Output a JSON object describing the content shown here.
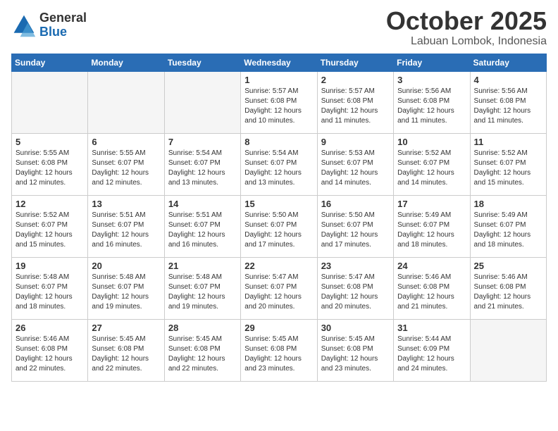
{
  "logo": {
    "general": "General",
    "blue": "Blue"
  },
  "title": "October 2025",
  "location": "Labuan Lombok, Indonesia",
  "days_of_week": [
    "Sunday",
    "Monday",
    "Tuesday",
    "Wednesday",
    "Thursday",
    "Friday",
    "Saturday"
  ],
  "weeks": [
    [
      {
        "day": "",
        "info": ""
      },
      {
        "day": "",
        "info": ""
      },
      {
        "day": "",
        "info": ""
      },
      {
        "day": "1",
        "info": "Sunrise: 5:57 AM\nSunset: 6:08 PM\nDaylight: 12 hours and 10 minutes."
      },
      {
        "day": "2",
        "info": "Sunrise: 5:57 AM\nSunset: 6:08 PM\nDaylight: 12 hours and 11 minutes."
      },
      {
        "day": "3",
        "info": "Sunrise: 5:56 AM\nSunset: 6:08 PM\nDaylight: 12 hours and 11 minutes."
      },
      {
        "day": "4",
        "info": "Sunrise: 5:56 AM\nSunset: 6:08 PM\nDaylight: 12 hours and 11 minutes."
      }
    ],
    [
      {
        "day": "5",
        "info": "Sunrise: 5:55 AM\nSunset: 6:08 PM\nDaylight: 12 hours and 12 minutes."
      },
      {
        "day": "6",
        "info": "Sunrise: 5:55 AM\nSunset: 6:07 PM\nDaylight: 12 hours and 12 minutes."
      },
      {
        "day": "7",
        "info": "Sunrise: 5:54 AM\nSunset: 6:07 PM\nDaylight: 12 hours and 13 minutes."
      },
      {
        "day": "8",
        "info": "Sunrise: 5:54 AM\nSunset: 6:07 PM\nDaylight: 12 hours and 13 minutes."
      },
      {
        "day": "9",
        "info": "Sunrise: 5:53 AM\nSunset: 6:07 PM\nDaylight: 12 hours and 14 minutes."
      },
      {
        "day": "10",
        "info": "Sunrise: 5:52 AM\nSunset: 6:07 PM\nDaylight: 12 hours and 14 minutes."
      },
      {
        "day": "11",
        "info": "Sunrise: 5:52 AM\nSunset: 6:07 PM\nDaylight: 12 hours and 15 minutes."
      }
    ],
    [
      {
        "day": "12",
        "info": "Sunrise: 5:52 AM\nSunset: 6:07 PM\nDaylight: 12 hours and 15 minutes."
      },
      {
        "day": "13",
        "info": "Sunrise: 5:51 AM\nSunset: 6:07 PM\nDaylight: 12 hours and 16 minutes."
      },
      {
        "day": "14",
        "info": "Sunrise: 5:51 AM\nSunset: 6:07 PM\nDaylight: 12 hours and 16 minutes."
      },
      {
        "day": "15",
        "info": "Sunrise: 5:50 AM\nSunset: 6:07 PM\nDaylight: 12 hours and 17 minutes."
      },
      {
        "day": "16",
        "info": "Sunrise: 5:50 AM\nSunset: 6:07 PM\nDaylight: 12 hours and 17 minutes."
      },
      {
        "day": "17",
        "info": "Sunrise: 5:49 AM\nSunset: 6:07 PM\nDaylight: 12 hours and 18 minutes."
      },
      {
        "day": "18",
        "info": "Sunrise: 5:49 AM\nSunset: 6:07 PM\nDaylight: 12 hours and 18 minutes."
      }
    ],
    [
      {
        "day": "19",
        "info": "Sunrise: 5:48 AM\nSunset: 6:07 PM\nDaylight: 12 hours and 18 minutes."
      },
      {
        "day": "20",
        "info": "Sunrise: 5:48 AM\nSunset: 6:07 PM\nDaylight: 12 hours and 19 minutes."
      },
      {
        "day": "21",
        "info": "Sunrise: 5:48 AM\nSunset: 6:07 PM\nDaylight: 12 hours and 19 minutes."
      },
      {
        "day": "22",
        "info": "Sunrise: 5:47 AM\nSunset: 6:07 PM\nDaylight: 12 hours and 20 minutes."
      },
      {
        "day": "23",
        "info": "Sunrise: 5:47 AM\nSunset: 6:08 PM\nDaylight: 12 hours and 20 minutes."
      },
      {
        "day": "24",
        "info": "Sunrise: 5:46 AM\nSunset: 6:08 PM\nDaylight: 12 hours and 21 minutes."
      },
      {
        "day": "25",
        "info": "Sunrise: 5:46 AM\nSunset: 6:08 PM\nDaylight: 12 hours and 21 minutes."
      }
    ],
    [
      {
        "day": "26",
        "info": "Sunrise: 5:46 AM\nSunset: 6:08 PM\nDaylight: 12 hours and 22 minutes."
      },
      {
        "day": "27",
        "info": "Sunrise: 5:45 AM\nSunset: 6:08 PM\nDaylight: 12 hours and 22 minutes."
      },
      {
        "day": "28",
        "info": "Sunrise: 5:45 AM\nSunset: 6:08 PM\nDaylight: 12 hours and 22 minutes."
      },
      {
        "day": "29",
        "info": "Sunrise: 5:45 AM\nSunset: 6:08 PM\nDaylight: 12 hours and 23 minutes."
      },
      {
        "day": "30",
        "info": "Sunrise: 5:45 AM\nSunset: 6:08 PM\nDaylight: 12 hours and 23 minutes."
      },
      {
        "day": "31",
        "info": "Sunrise: 5:44 AM\nSunset: 6:09 PM\nDaylight: 12 hours and 24 minutes."
      },
      {
        "day": "",
        "info": ""
      }
    ]
  ]
}
